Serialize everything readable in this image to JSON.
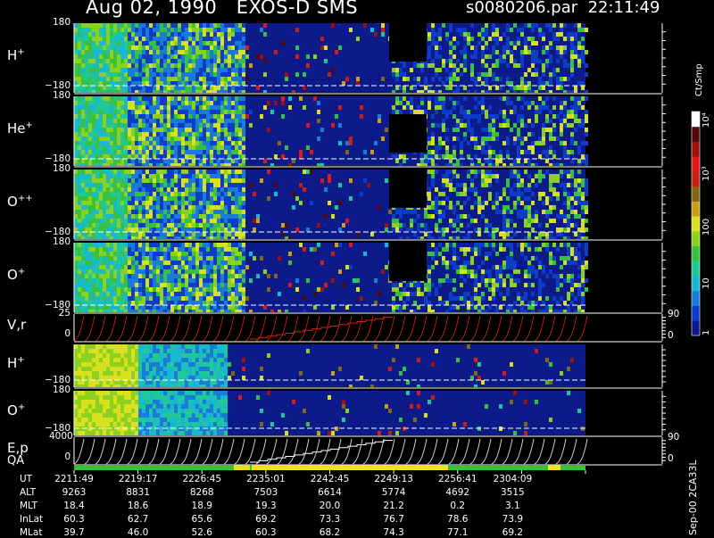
{
  "header": {
    "title_left": "Aug 02, 1990   EXOS-D SMS",
    "title_right": "s0080206.par  22:11:49"
  },
  "panels": [
    {
      "label": "H⁺",
      "label_base": "H",
      "label_sup": "+",
      "y_top": "180",
      "y_bottom": "−180",
      "type": "spectrogram",
      "right": ""
    },
    {
      "label": "He⁺",
      "label_base": "He",
      "label_sup": "+",
      "y_top": "180",
      "y_bottom": "−180",
      "type": "spectrogram",
      "right": ""
    },
    {
      "label": "O⁺⁺",
      "label_base": "O",
      "label_sup": "++",
      "y_top": "180",
      "y_bottom": "−180",
      "type": "spectrogram",
      "right": ""
    },
    {
      "label": "O⁺",
      "label_base": "O",
      "label_sup": "+",
      "y_top": "180",
      "y_bottom": "−180",
      "type": "spectrogram",
      "right": ""
    },
    {
      "label": "V,r",
      "label_base": "V,r",
      "label_sup": "",
      "y_top": "25",
      "y_bottom": "0",
      "type": "line",
      "right_top": "90",
      "right_bottom": "0"
    },
    {
      "label": "H⁺",
      "label_base": "H",
      "label_sup": "+",
      "y_top": "",
      "y_bottom": "−180",
      "type": "spectrogram",
      "right": ""
    },
    {
      "label": "O⁺",
      "label_base": "O",
      "label_sup": "+",
      "y_top": "180",
      "y_bottom": "−180",
      "type": "spectrogram",
      "right": ""
    },
    {
      "label": "E,p",
      "label_base": "E,p",
      "label_sup": "",
      "y_top": "4000",
      "y_bottom": "0",
      "type": "line",
      "right_top": "90",
      "right_bottom": "0"
    }
  ],
  "qa_label": "QA",
  "colorbar": {
    "unit": "Ct/Smp",
    "ticks": [
      "1",
      "10",
      "100",
      "10³",
      "10⁴"
    ],
    "colors": [
      "#0a1a8c",
      "#0c3cc8",
      "#1a7ad8",
      "#18b8d0",
      "#20c898",
      "#38c040",
      "#8cd020",
      "#d8e020",
      "#c8a018",
      "#806818",
      "#c82010",
      "#e01818",
      "#a01010",
      "#500808",
      "#ffffff"
    ]
  },
  "ephemeris": {
    "labels": [
      "UT",
      "ALT",
      "MLT",
      "InLat",
      "MLat"
    ],
    "columns": [
      {
        "UT": "2211:49",
        "ALT": "9263",
        "MLT": "18.4",
        "InLat": "60.3",
        "MLat": "39.7"
      },
      {
        "UT": "2219:17",
        "ALT": "8831",
        "MLT": "18.6",
        "InLat": "62.7",
        "MLat": "46.0"
      },
      {
        "UT": "2226:45",
        "ALT": "8268",
        "MLT": "18.9",
        "InLat": "65.6",
        "MLat": "52.6"
      },
      {
        "UT": "2235:01",
        "ALT": "7503",
        "MLT": "19.3",
        "InLat": "69.2",
        "MLat": "60.3"
      },
      {
        "UT": "2242:45",
        "ALT": "6614",
        "MLT": "20.0",
        "InLat": "73.3",
        "MLat": "68.2"
      },
      {
        "UT": "2249:13",
        "ALT": "5774",
        "MLT": "21.2",
        "InLat": "76.7",
        "MLat": "74.3"
      },
      {
        "UT": "2256:41",
        "ALT": "4692",
        "MLT": "0.2",
        "InLat": "78.6",
        "MLat": "77.1"
      },
      {
        "UT": "2304:09",
        "ALT": "3515",
        "MLT": "3.1",
        "InLat": "73.9",
        "MLat": "69.2"
      }
    ]
  },
  "file_stamp": "Sep-00  2CA33L"
}
